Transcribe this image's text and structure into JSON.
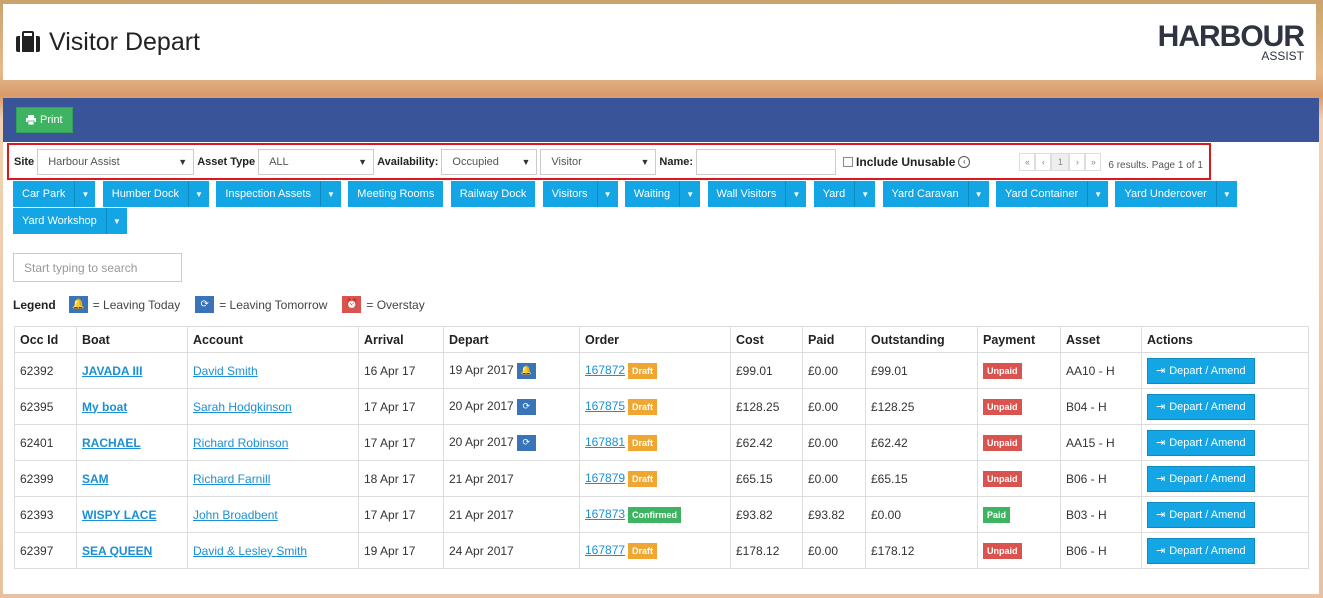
{
  "header": {
    "title": "Visitor Depart",
    "logo_main": "HARBOUR",
    "logo_sub": "ASSIST"
  },
  "toolbar": {
    "print_label": "Print"
  },
  "filters": {
    "site_label": "Site",
    "site_value": "Harbour Assist",
    "asset_type_label": "Asset Type",
    "asset_type_value": "ALL",
    "availability_label": "Availability:",
    "availability_value": "Occupied",
    "visitor_value": "Visitor",
    "name_label": "Name:",
    "name_value": "",
    "include_unusable_label": "Include Unusable",
    "pager": [
      "«",
      "‹",
      "1",
      "›",
      "»"
    ],
    "results_text": "6 results. Page 1 of 1"
  },
  "asset_tabs": [
    "Car Park",
    "Humber Dock",
    "Inspection Assets",
    "Meeting Rooms",
    "Railway Dock",
    "Visitors",
    "Waiting",
    "Wall Visitors",
    "Yard",
    "Yard Caravan",
    "Yard Container",
    "Yard Undercover",
    "Yard Workshop"
  ],
  "search": {
    "placeholder": "Start typing to search"
  },
  "legend": {
    "title": "Legend",
    "leaving_today": "= Leaving Today",
    "leaving_tomorrow": "= Leaving Tomorrow",
    "overstay": "= Overstay"
  },
  "table": {
    "columns": [
      "Occ Id",
      "Boat",
      "Account",
      "Arrival",
      "Depart",
      "Order",
      "Cost",
      "Paid",
      "Outstanding",
      "Payment",
      "Asset",
      "Actions"
    ],
    "action_label": "Depart / Amend",
    "rows": [
      {
        "occ": "62392",
        "boat": "JAVADA III",
        "account": "David Smith",
        "arrival": "16 Apr 17",
        "depart": "19 Apr 2017",
        "depart_icon": "bell-icon",
        "order": "167872",
        "order_status": "Draft",
        "cost": "£99.01",
        "paid": "£0.00",
        "outstanding": "£99.01",
        "payment": "Unpaid",
        "asset": "AA10 - H"
      },
      {
        "occ": "62395",
        "boat": "My boat",
        "account": "Sarah Hodgkinson",
        "arrival": "17 Apr 17",
        "depart": "20 Apr 2017",
        "depart_icon": "refresh-icon",
        "order": "167875",
        "order_status": "Draft",
        "cost": "£128.25",
        "paid": "£0.00",
        "outstanding": "£128.25",
        "payment": "Unpaid",
        "asset": "B04 - H"
      },
      {
        "occ": "62401",
        "boat": "RACHAEL",
        "account": "Richard Robinson",
        "arrival": "17 Apr 17",
        "depart": "20 Apr 2017",
        "depart_icon": "refresh-icon",
        "order": "167881",
        "order_status": "Draft",
        "cost": "£62.42",
        "paid": "£0.00",
        "outstanding": "£62.42",
        "payment": "Unpaid",
        "asset": "AA15 - H"
      },
      {
        "occ": "62399",
        "boat": "SAM",
        "account": "Richard Farnill",
        "arrival": "18 Apr 17",
        "depart": "21 Apr 2017",
        "depart_icon": "",
        "order": "167879",
        "order_status": "Draft",
        "cost": "£65.15",
        "paid": "£0.00",
        "outstanding": "£65.15",
        "payment": "Unpaid",
        "asset": "B06 - H"
      },
      {
        "occ": "62393",
        "boat": "WISPY LACE",
        "account": "John Broadbent",
        "arrival": "17 Apr 17",
        "depart": "21 Apr 2017",
        "depart_icon": "",
        "order": "167873",
        "order_status": "Confirmed",
        "cost": "£93.82",
        "paid": "£93.82",
        "outstanding": "£0.00",
        "payment": "Paid",
        "asset": "B03 - H"
      },
      {
        "occ": "62397",
        "boat": "SEA QUEEN",
        "account": "David & Lesley Smith",
        "arrival": "19 Apr 17",
        "depart": "24 Apr 2017",
        "depart_icon": "",
        "order": "167877",
        "order_status": "Draft",
        "cost": "£178.12",
        "paid": "£0.00",
        "outstanding": "£178.12",
        "payment": "Unpaid",
        "asset": "B06 - H"
      }
    ]
  }
}
